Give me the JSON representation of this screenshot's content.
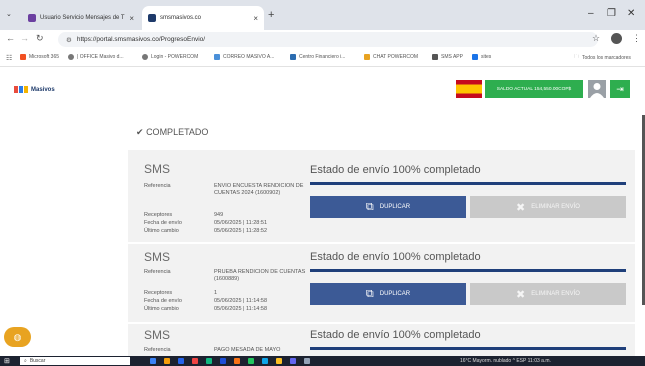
{
  "browser": {
    "tabs": [
      {
        "label": "Usuario Servicio Mensajes de T",
        "favicon_color": "#6b3fa0"
      },
      {
        "label": "smsmasivos.co",
        "favicon_color": "#1e3a6a"
      }
    ],
    "url": "https://portal.smsmasivos.co/ProgresoEnvio/",
    "bookmarks": [
      "Microsoft 365",
      "| OFFICE Masivo d...",
      "Login - POWERCOM",
      "CORREO MASIVO A...",
      "Centro Financiero i...",
      "CHAT POWERCOM",
      "SMS APP",
      "sites"
    ],
    "bookmarks_folder": "Todos los marcadores"
  },
  "header": {
    "logo_text": "Masivos",
    "saldo": "SALDO ACTUAL 154,550.00COP$"
  },
  "section_title": "COMPLETADO",
  "cards": [
    {
      "type": "SMS",
      "referencia_label": "Referencia",
      "referencia": "ENVIO ENCUESTA RENDICION DE CUENTAS 2024 (1600902)",
      "receptores_label": "Receptores",
      "receptores": "949",
      "fecha_label": "Fecha de envío",
      "fecha": "05/06/2025 | 11:28:51",
      "cambio_label": "Último cambio",
      "cambio": "05/06/2025 | 11:28:52",
      "estado": "Estado de envío 100% completado",
      "progress": 1.0,
      "dup": "DUPLICAR",
      "elim": "ELIMINAR ENVÍO"
    },
    {
      "type": "SMS",
      "referencia_label": "Referencia",
      "referencia": "PRUEBA RENDICION DE CUENTAS (1600889)",
      "receptores_label": "Receptores",
      "receptores": "1",
      "fecha_label": "Fecha de envío",
      "fecha": "05/06/2025 | 11:14:58",
      "cambio_label": "Último cambio",
      "cambio": "05/06/2025 | 11:14:58",
      "estado": "Estado de envío 100% completado",
      "progress": 1.0,
      "dup": "DUPLICAR",
      "elim": "ELIMINAR ENVÍO"
    },
    {
      "type": "SMS",
      "referencia_label": "Referencia",
      "referencia": "PAGO MESADA DE MAYO",
      "estado": "Estado de envío 100% completado",
      "progress": 1.0
    }
  ],
  "taskbar": {
    "search_placeholder": "Buscar",
    "tray": "16°C  Mayorm. nublado   ^  ESP   11:03 a.m."
  }
}
